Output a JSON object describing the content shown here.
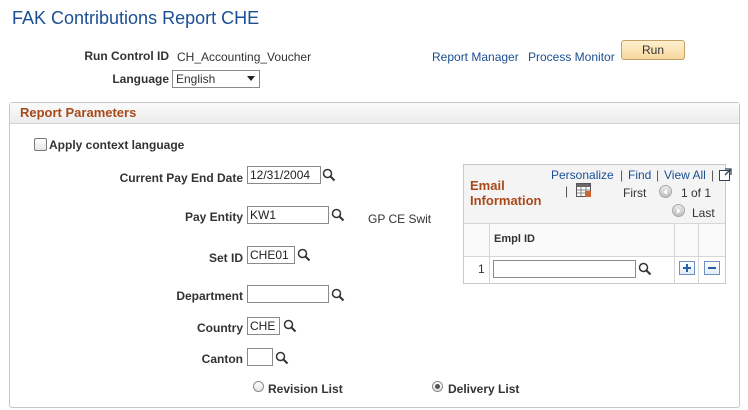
{
  "page": {
    "title": "FAK Contributions Report CHE"
  },
  "header": {
    "run_control_label": "Run Control ID",
    "run_control_value": "CH_Accounting_Voucher",
    "language_label": "Language",
    "language_value": "English",
    "report_manager": "Report Manager",
    "process_monitor": "Process Monitor",
    "run_label": "Run"
  },
  "params": {
    "section_title": "Report Parameters",
    "apply_context_language": "Apply context language",
    "current_pay_end_date_label": "Current Pay End Date",
    "current_pay_end_date_value": "12/31/2004",
    "pay_entity_label": "Pay Entity",
    "pay_entity_value": "KW1",
    "pay_entity_desc": "GP CE Swit",
    "set_id_label": "Set ID",
    "set_id_value": "CHE01",
    "department_label": "Department",
    "department_value": "",
    "country_label": "Country",
    "country_value": "CHE",
    "canton_label": "Canton",
    "canton_value": "",
    "revision_list": "Revision List",
    "delivery_list": "Delivery List"
  },
  "email_grid": {
    "title_line1": "Email",
    "title_line2": "Information",
    "personalize": "Personalize",
    "find": "Find",
    "view_all": "View All",
    "sep": "|",
    "first": "First",
    "page_info": "1 of 1",
    "last": "Last",
    "col_empl_id": "Empl ID",
    "rows": [
      {
        "num": "1",
        "empl_id": ""
      }
    ]
  },
  "colors": {
    "title": "#1a4f93",
    "section": "#a8491a",
    "link": "#1a4f93"
  }
}
